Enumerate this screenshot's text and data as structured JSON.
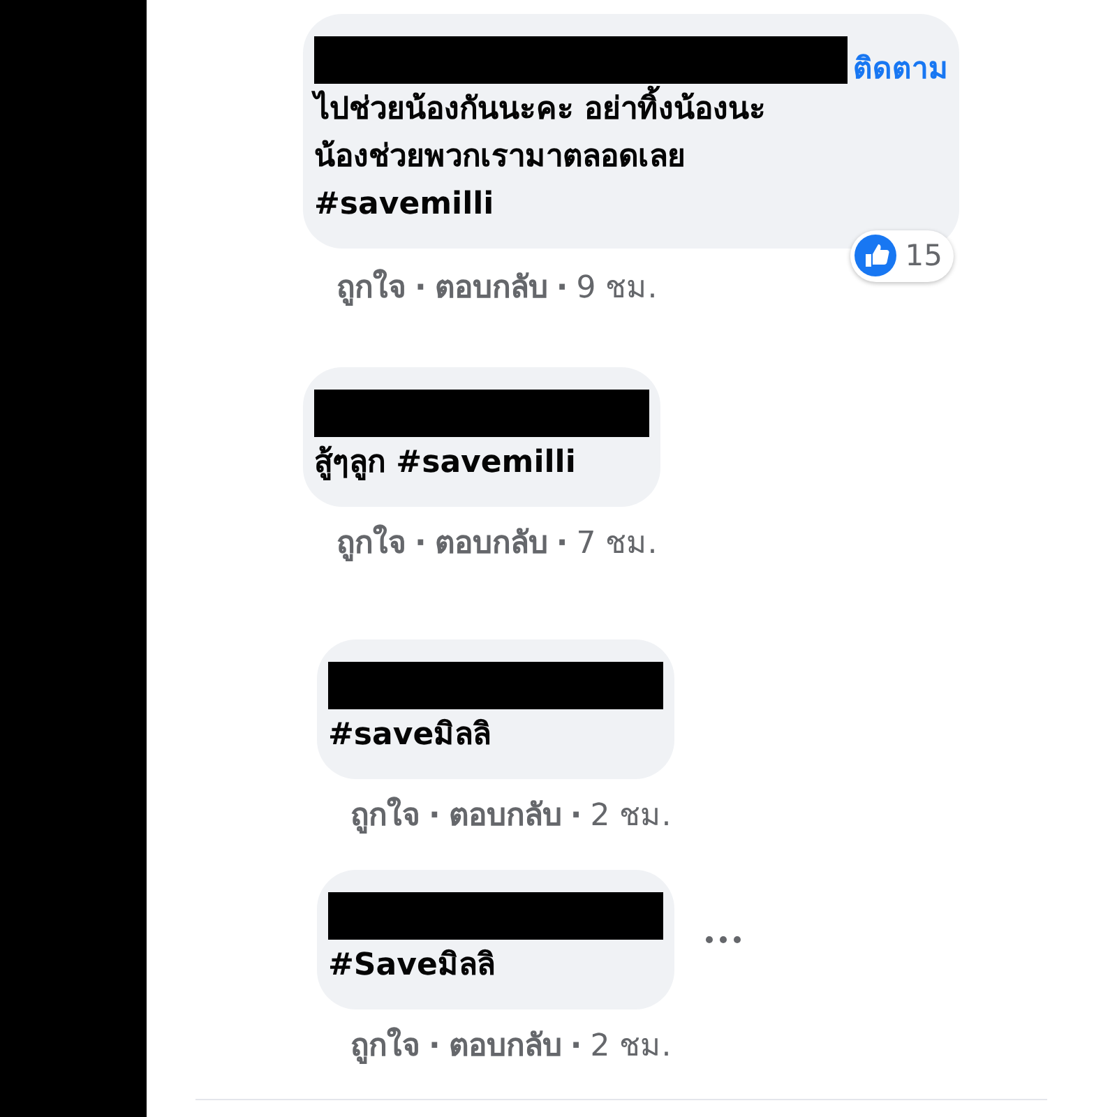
{
  "comments": [
    {
      "follow_link": "ติดตาม",
      "text_lines": [
        "ไปช่วยน้องกันนะคะ อย่าทิ้งน้องนะ",
        "น้องช่วยพวกเรามาตลอดเลย",
        "#savemilli"
      ],
      "reaction_count": "15",
      "actions": [
        "ถูกใจ",
        "ตอบกลับ"
      ],
      "separator": "·",
      "time": "9 ชม.",
      "more_button": false
    },
    {
      "text_lines": [
        "สู้ๆลูก #savemilli"
      ],
      "actions": [
        "ถูกใจ",
        "ตอบกลับ"
      ],
      "separator": "·",
      "time": "7 ชม.",
      "more_button": false
    },
    {
      "text_lines": [
        "#saveมิลลิ"
      ],
      "actions": [
        "ถูกใจ",
        "ตอบกลับ"
      ],
      "separator": "·",
      "time": "2 ชม.",
      "more_button": false
    },
    {
      "text_lines": [
        "#Saveมิลลิ"
      ],
      "actions": [
        "ถูกใจ",
        "ตอบกลับ"
      ],
      "separator": "·",
      "time": "2 ชม.",
      "more_button": true
    }
  ]
}
